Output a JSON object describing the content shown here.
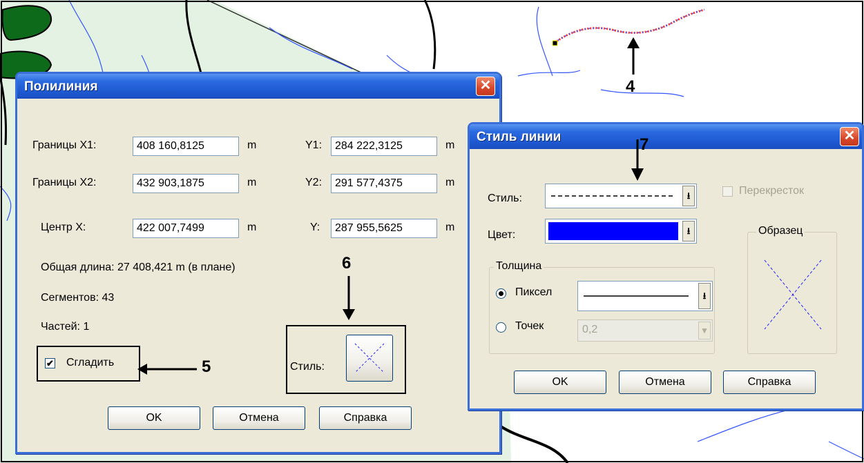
{
  "polyline_dialog": {
    "title": "Полилиния",
    "close_label": "✕",
    "bounds_x1_label": "Границы X1:",
    "bounds_x1_value": "408 160,8125",
    "bounds_x1_unit": "m",
    "y1_label": "Y1:",
    "y1_value": "284 222,3125",
    "y1_unit": "m",
    "bounds_x2_label": "Границы X2:",
    "bounds_x2_value": "432 903,1875",
    "bounds_x2_unit": "m",
    "y2_label": "Y2:",
    "y2_value": "291 577,4375",
    "y2_unit": "m",
    "center_x_label": "Центр X:",
    "center_x_value": "422 007,7499",
    "center_x_unit": "m",
    "center_y_label": "Y:",
    "center_y_value": "287 955,5625",
    "center_y_unit": "m",
    "total_length": "Общая длина:  27 408,421 m (в плане)",
    "segments": "Сегментов:  43",
    "parts": "Частей:  1",
    "smooth_label": "Сгладить",
    "smooth_checked": true,
    "style_label": "Стиль:",
    "ok_label": "OK",
    "cancel_label": "Отмена",
    "help_label": "Справка"
  },
  "line_style_dialog": {
    "title": "Стиль линии",
    "close_label": "✕",
    "style_label": "Стиль:",
    "color_label": "Цвет:",
    "color_value": "#0000ff",
    "crossing_label": "Перекресток",
    "crossing_checked": false,
    "thickness_group_label": "Толщина",
    "pixel_label": "Пиксел",
    "points_label": "Точек",
    "points_value": "0,2",
    "sample_group_label": "Образец",
    "ok_label": "OK",
    "cancel_label": "Отмена",
    "help_label": "Справка",
    "dropdown_arrow": "⭳"
  },
  "annotations": {
    "label_4": "4",
    "label_5": "5",
    "label_6": "6",
    "label_7": "7"
  },
  "colors": {
    "title_bar": "#1f5ad2",
    "dialog_bg": "#ece9d8",
    "map_green_area": "#e4f2e4",
    "map_dark_green": "#0c6a1a",
    "river_blue": "#3355ff",
    "sample_line": "#2222ff"
  }
}
